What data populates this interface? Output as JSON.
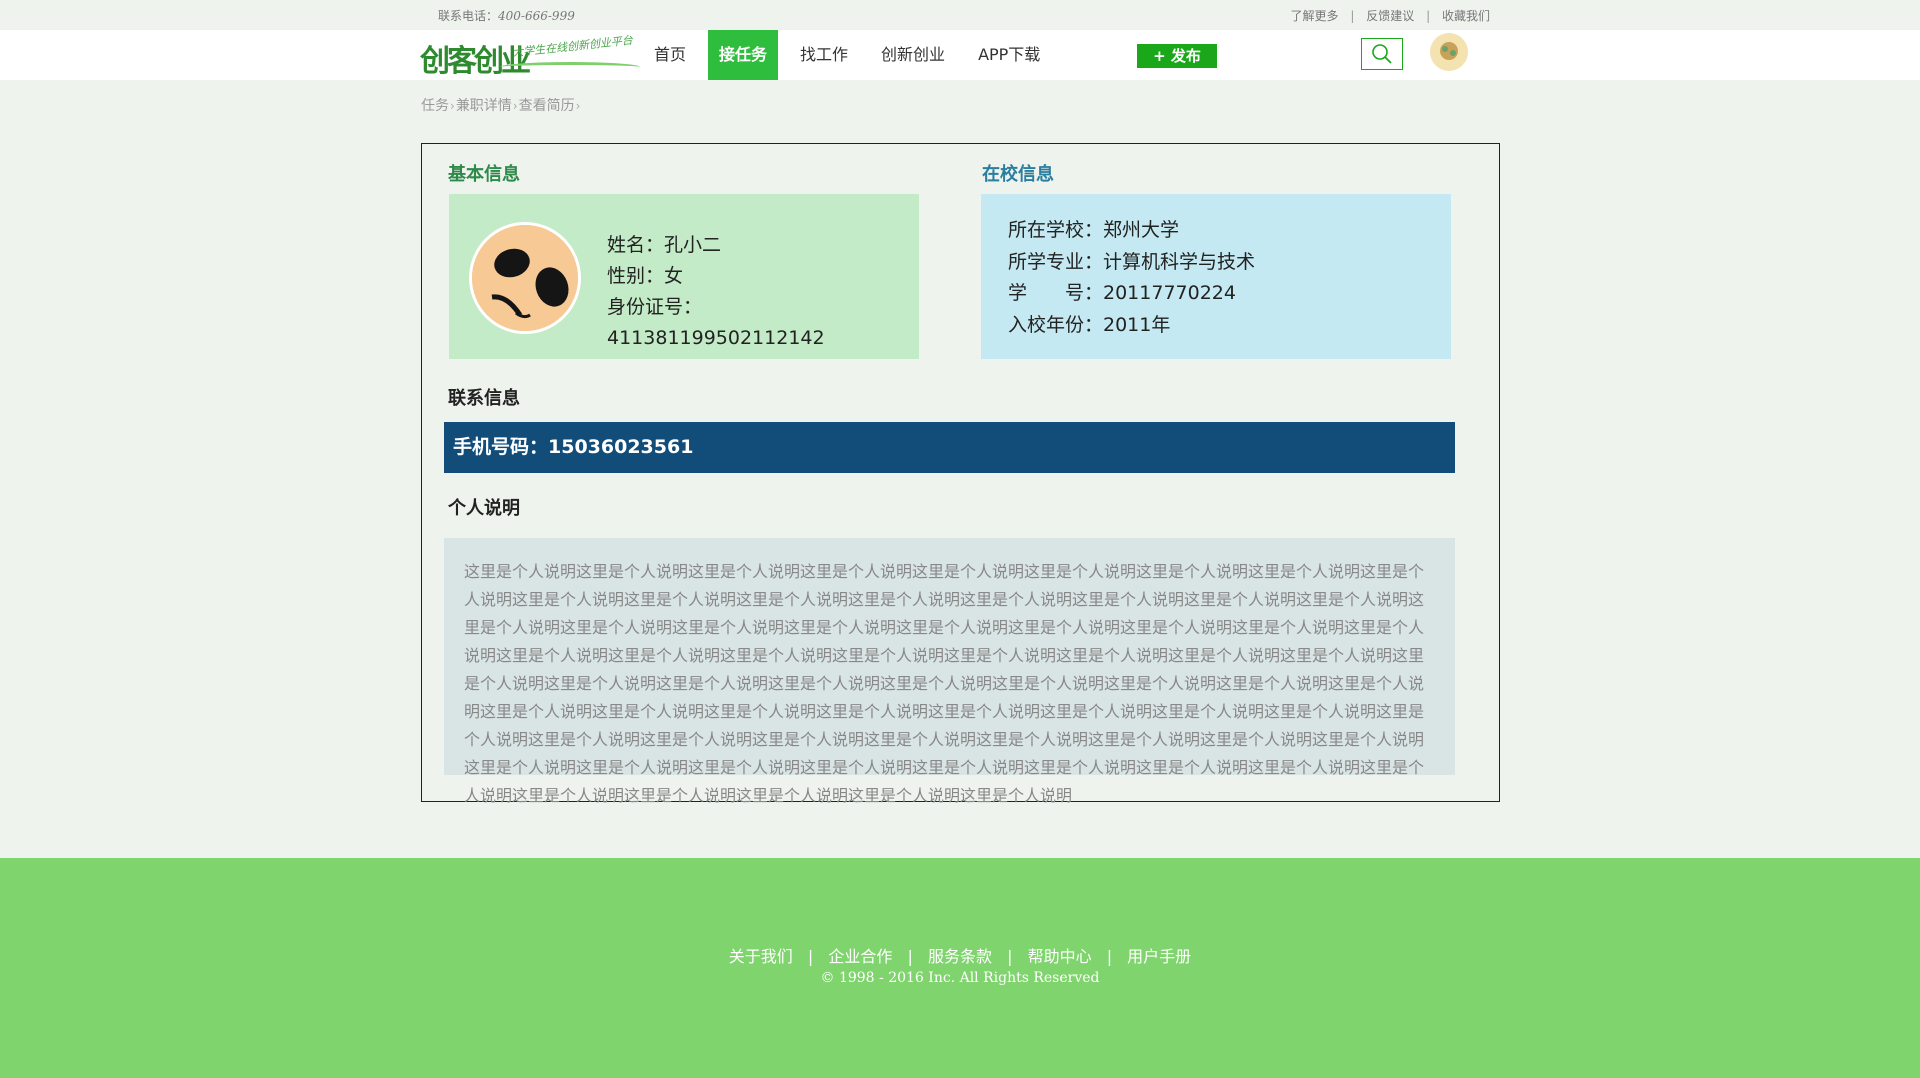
{
  "topbar": {
    "phone_label": "联系电话：",
    "phone_number": "400-666-999",
    "links": [
      "了解更多",
      "反馈建议",
      "收藏我们"
    ],
    "separator": "|"
  },
  "header": {
    "logo_mark": "创客创业",
    "logo_slogan": "大学生在线创新创业平台",
    "nav": [
      "首页",
      "接任务",
      "找工作",
      "创新创业",
      "APP下载"
    ],
    "active_nav": "接任务",
    "publish_label": "+ 发布",
    "publish_color": "#1aa81a",
    "search_icon": "search-icon"
  },
  "breadcrumb": [
    "任务",
    "兼职详情",
    "查看简历"
  ],
  "breadcrumb_arrow": "›",
  "basic": {
    "title": "基本信息",
    "name": "姓名：孔小二",
    "gender": "性别：女",
    "id_number": "身份证号：411381199502112142"
  },
  "school": {
    "title": "在校信息",
    "school": "所在学校：郑州大学",
    "major": "所学专业：计算机科学与技术",
    "student_no": "学　　号：20117770224",
    "year": "入校年份：2011年"
  },
  "contact": {
    "title": "联系信息",
    "phone": "手机号码：15036023561",
    "bar_color": "#124d7a"
  },
  "description": {
    "title": "个人说明",
    "text": "这里是个人说明这里是个人说明这里是个人说明这里是个人说明这里是个人说明这里是个人说明这里是个人说明这里是个人说明这里是个人说明这里是个人说明这里是个人说明这里是个人说明这里是个人说明这里是个人说明这里是个人说明这里是个人说明这里是个人说明这里是个人说明这里是个人说明这里是个人说明这里是个人说明这里是个人说明这里是个人说明这里是个人说明这里是个人说明这里是个人说明这里是个人说明这里是个人说明这里是个人说明这里是个人说明这里是个人说明这里是个人说明这里是个人说明这里是个人说明这里是个人说明这里是个人说明这里是个人说明这里是个人说明这里是个人说明这里是个人说明这里是个人说明这里是个人说明这里是个人说明这里是个人说明这里是个人说明这里是个人说明这里是个人说明这里是个人说明这里是个人说明这里是个人说明这里是个人说明这里是个人说明这里是个人说明这里是个人说明这里是个人说明这里是个人说明这里是个人说明这里是个人说明这里是个人说明这里是个人说明这里是个人说明这里是个人说明这里是个人说明这里是个人说明这里是个人说明这里是个人说明这里是个人说明这里是个人说明这里是个人说明这里是个人说明这里是个人说明这里是个人说明这里是个人说明这里是个人说明"
  },
  "footer": {
    "links": [
      "关于我们",
      "企业合作",
      "服务条款",
      "帮助中心",
      "用户手册"
    ],
    "separator": "|",
    "copyright": "© 1998 - 2016  Inc. All Rights Reserved",
    "bg_color": "#7fd46e"
  }
}
